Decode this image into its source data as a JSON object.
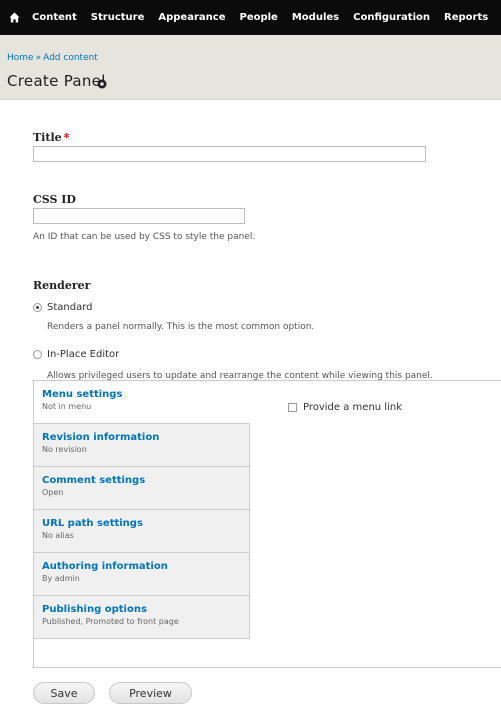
{
  "toolbar": {
    "home_icon": "home-icon",
    "menu": [
      "Content",
      "Structure",
      "Appearance",
      "People",
      "Modules",
      "Configuration",
      "Reports"
    ]
  },
  "breadcrumb": {
    "home": "Home",
    "separator": "»",
    "current": "Add content"
  },
  "page": {
    "title": "Create Panel",
    "shortcut_icon": "add-shortcut-icon"
  },
  "form": {
    "title_label": "Title",
    "required_mark": "*",
    "title_value": "",
    "css_id_label": "CSS ID",
    "css_id_value": "",
    "css_id_desc": "An ID that can be used by CSS to style the panel.",
    "renderer_label": "Renderer",
    "renderer_options": [
      {
        "label": "Standard",
        "desc": "Renders a panel normally. This is the most common option.",
        "selected": true
      },
      {
        "label": "In-Place Editor",
        "desc": "Allows privileged users to update and rearrange the content while viewing this panel.",
        "selected": false
      }
    ]
  },
  "vertical_tabs": [
    {
      "title": "Menu settings",
      "summary": "Not in menu",
      "active": true
    },
    {
      "title": "Revision information",
      "summary": "No revision",
      "active": false
    },
    {
      "title": "Comment settings",
      "summary": "Open",
      "active": false
    },
    {
      "title": "URL path settings",
      "summary": "No alias",
      "active": false
    },
    {
      "title": "Authoring information",
      "summary": "By admin",
      "active": false
    },
    {
      "title": "Publishing options",
      "summary": "Published, Promoted to front page",
      "active": false
    }
  ],
  "menu_settings": {
    "provide_menu_link": "Provide a menu link",
    "checked": false
  },
  "actions": {
    "save": "Save",
    "preview": "Preview"
  },
  "colors": {
    "toolbar_bg": "#0b0b0b",
    "header_bg": "#e6e5dd",
    "link": "#0074bd",
    "required": "#e00000"
  }
}
